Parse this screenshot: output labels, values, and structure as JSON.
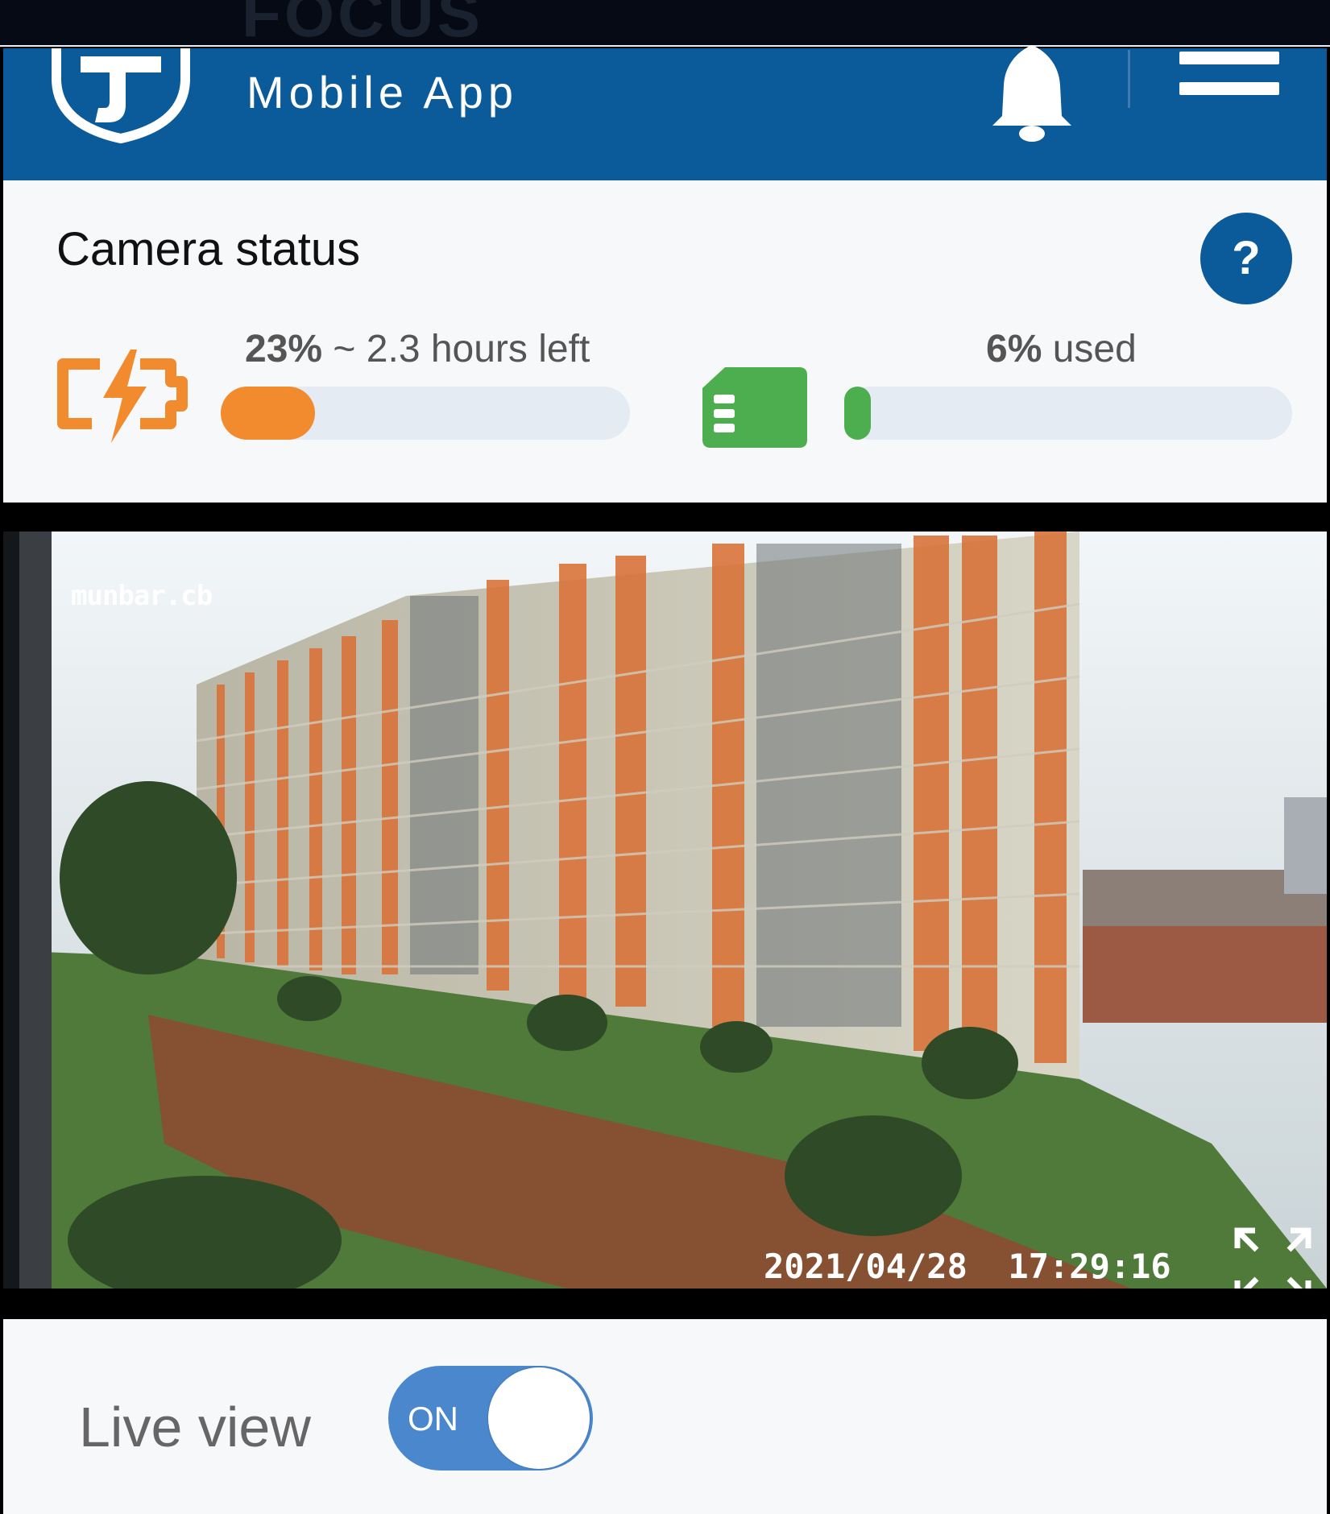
{
  "header": {
    "app_name": "FOCUS",
    "app_subtitle": "Mobile App",
    "brand_color": "#0b5a9a",
    "icons": [
      "shield-logo-icon",
      "bell-icon",
      "hamburger-menu-icon"
    ]
  },
  "status": {
    "title": "Camera status",
    "help_label": "?",
    "battery": {
      "percent_text": "23%",
      "remaining_text": " ~ 2.3 hours left",
      "level": 0.23,
      "color": "#f28a2e"
    },
    "storage": {
      "percent_text": "6%",
      "used_text": " used",
      "level": 0.06,
      "color": "#4cae4f"
    }
  },
  "camera": {
    "overlay_tag": "munbar.cb",
    "timestamp": "2021/04/28  17:29:16",
    "fullscreen_icon": "expand-arrows-icon"
  },
  "live_view": {
    "label": "Live view",
    "toggle_text": "ON",
    "enabled": true
  }
}
